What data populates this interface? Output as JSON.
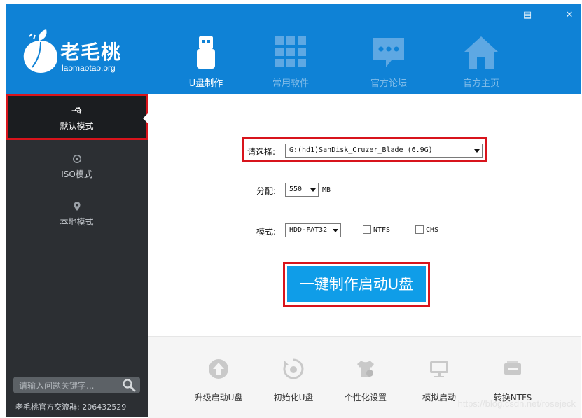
{
  "brand": {
    "name": "老毛桃",
    "domain": "laomaotao.org"
  },
  "window_controls": {
    "menu": "▤",
    "minimize": "—",
    "close": "✕"
  },
  "tabs": [
    {
      "label": "U盘制作",
      "icon": "usb-drive-icon",
      "active": true
    },
    {
      "label": "常用软件",
      "icon": "grid-apps-icon",
      "active": false
    },
    {
      "label": "官方论坛",
      "icon": "chat-bubble-icon",
      "active": false
    },
    {
      "label": "官方主页",
      "icon": "home-icon",
      "active": false
    }
  ],
  "sidebar": {
    "modes": [
      {
        "label": "默认模式",
        "icon": "usb-symbol-icon",
        "active": true
      },
      {
        "label": "ISO模式",
        "icon": "disc-icon",
        "active": false
      },
      {
        "label": "本地模式",
        "icon": "location-pin-icon",
        "active": false
      }
    ],
    "search_placeholder": "请输入问题关键字...",
    "group": "老毛桃官方交流群: 206432529"
  },
  "form": {
    "device_label": "请选择:",
    "device_value": "G:(hd1)SanDisk_Cruzer_Blade (6.9G)",
    "alloc_label": "分配:",
    "alloc_value": "550",
    "alloc_unit": "MB",
    "mode_label": "模式:",
    "mode_value": "HDD-FAT32",
    "ntfs_label": "NTFS",
    "chs_label": "CHS",
    "make_button": "一键制作启动U盘"
  },
  "tools": [
    {
      "label": "升级启动U盘",
      "icon": "upgrade-icon"
    },
    {
      "label": "初始化U盘",
      "icon": "format-icon"
    },
    {
      "label": "个性化设置",
      "icon": "shirt-icon"
    },
    {
      "label": "模拟启动",
      "icon": "monitor-icon"
    },
    {
      "label": "转换NTFS",
      "icon": "ntfs-icon"
    }
  ],
  "watermark": "https://blog.csdn.net/rosejeck",
  "colors": {
    "header_blue": "#0f82d6",
    "sidebar_dark": "#2c2f33",
    "highlight_red": "#d8141c",
    "button_blue": "#0f9de8"
  }
}
